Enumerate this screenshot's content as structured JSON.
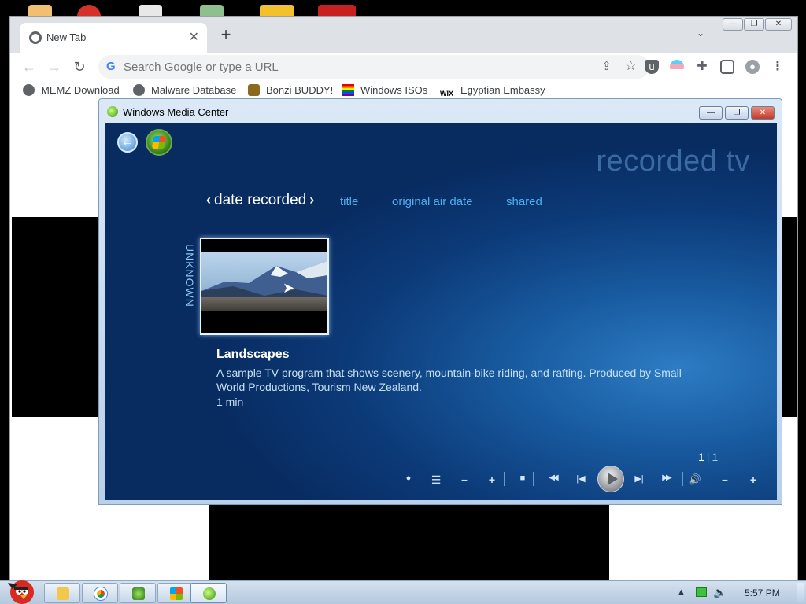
{
  "chrome": {
    "tab_title": "New Tab",
    "tab_close": "✕",
    "new_tab": "+",
    "tab_search": "⌄",
    "win_min": "—",
    "win_max": "❐",
    "win_close": "✕",
    "back": "←",
    "forward": "→",
    "reload": "↻",
    "omnibox_placeholder": "Search Google or type a URL",
    "share": "⇪",
    "star": "☆",
    "bookmarks": [
      {
        "label": "MEMZ Download",
        "icon": "globe-icon"
      },
      {
        "label": "Malware Database",
        "icon": "globe-icon"
      },
      {
        "label": "Bonzi BUDDY!",
        "icon": "bonzi-icon"
      },
      {
        "label": "Windows ISOs",
        "icon": "windows-flag-icon"
      },
      {
        "label": "Egyptian Embassy",
        "icon": "wix-icon"
      }
    ],
    "extensions": [
      "ublock-icon",
      "trans-flag-icon",
      "puzzle-icon",
      "sidebar-icon",
      "profile-icon",
      "kebab-menu-icon"
    ]
  },
  "wmc": {
    "window_title": "Windows Media Center",
    "ctl_min": "—",
    "ctl_max": "❐",
    "ctl_close": "✕",
    "section_title": "recorded tv",
    "pivots": {
      "active": "date recorded",
      "others": [
        "title",
        "original air date",
        "shared"
      ]
    },
    "group_label": "UNKNOWN",
    "program": {
      "title": "Landscapes",
      "description": "A sample TV program that shows scenery, mountain-bike riding, and rafting. Produced by Small World Productions, Tourism New Zealand.",
      "length": "1 min"
    },
    "pager": {
      "current": "1",
      "sep": "|",
      "total": "1"
    },
    "transport": {
      "record": "●",
      "guide": "☰",
      "ch_down": "−",
      "ch_up": "+",
      "stop": "■",
      "rewind": "◀◀",
      "prev": "|◀",
      "next": "▶|",
      "ffwd": "▶▶",
      "mute": "🔊",
      "vol_down": "−",
      "vol_up": "+"
    }
  },
  "taskbar": {
    "tasks": [
      "explorer-icon",
      "chrome-icon",
      "bonzi-icon",
      "windows-icon",
      "media-center-icon"
    ],
    "tray_up": "▲",
    "tray_vol": "🔈",
    "clock": "5:57 PM"
  },
  "colors": {
    "wmc_blue": "#0c3a78",
    "pivot_blue": "#4db0ef",
    "taskbar": "#c6d6e8"
  }
}
